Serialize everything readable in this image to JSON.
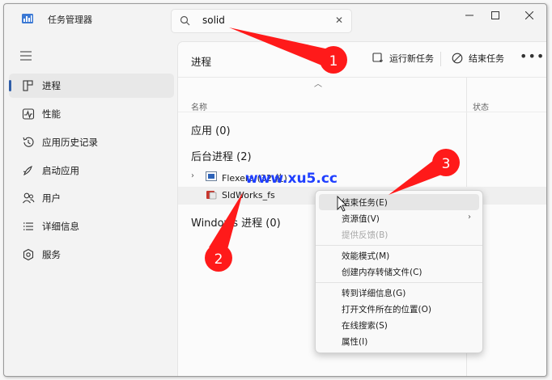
{
  "app": {
    "title": "任务管理器"
  },
  "search": {
    "value": "solid",
    "placeholder": ""
  },
  "sidebar": {
    "items": [
      {
        "label": "进程",
        "icon": "processes-icon",
        "active": true
      },
      {
        "label": "性能",
        "icon": "performance-icon"
      },
      {
        "label": "应用历史记录",
        "icon": "app-history-icon"
      },
      {
        "label": "启动应用",
        "icon": "startup-icon"
      },
      {
        "label": "用户",
        "icon": "users-icon"
      },
      {
        "label": "详细信息",
        "icon": "details-icon"
      },
      {
        "label": "服务",
        "icon": "services-icon"
      }
    ]
  },
  "main": {
    "title": "进程",
    "toolbar": {
      "run_new_task": "运行新任务",
      "end_task": "结束任务"
    },
    "columns": {
      "name": "名称",
      "status": "状态"
    },
    "groups": {
      "apps": "应用 (0)",
      "background": "后台进程 (2)",
      "windows": "Windows 进程 (0)"
    },
    "processes": [
      {
        "label": "Flexera (32 位)",
        "icon": "flexera-icon",
        "expandable": true
      },
      {
        "label": "SldWorks_fs",
        "icon": "solidworks-icon",
        "expandable": false,
        "selected": true
      }
    ]
  },
  "context_menu": {
    "items": [
      {
        "label": "结束任务(E)",
        "hover": true
      },
      {
        "label": "资源值(V)",
        "submenu": true
      },
      {
        "label": "提供反馈(B)",
        "disabled": true
      },
      {
        "label": "效能模式(M)"
      },
      {
        "label": "创建内存转储文件(C)"
      },
      {
        "label": "转到详细信息(G)"
      },
      {
        "label": "打开文件所在的位置(O)"
      },
      {
        "label": "在线搜索(S)"
      },
      {
        "label": "属性(I)"
      }
    ]
  },
  "annotations": {
    "watermark": "www.xu5.cc",
    "markers": [
      "1",
      "2",
      "3"
    ],
    "marker_color": "#ff1a1a"
  }
}
